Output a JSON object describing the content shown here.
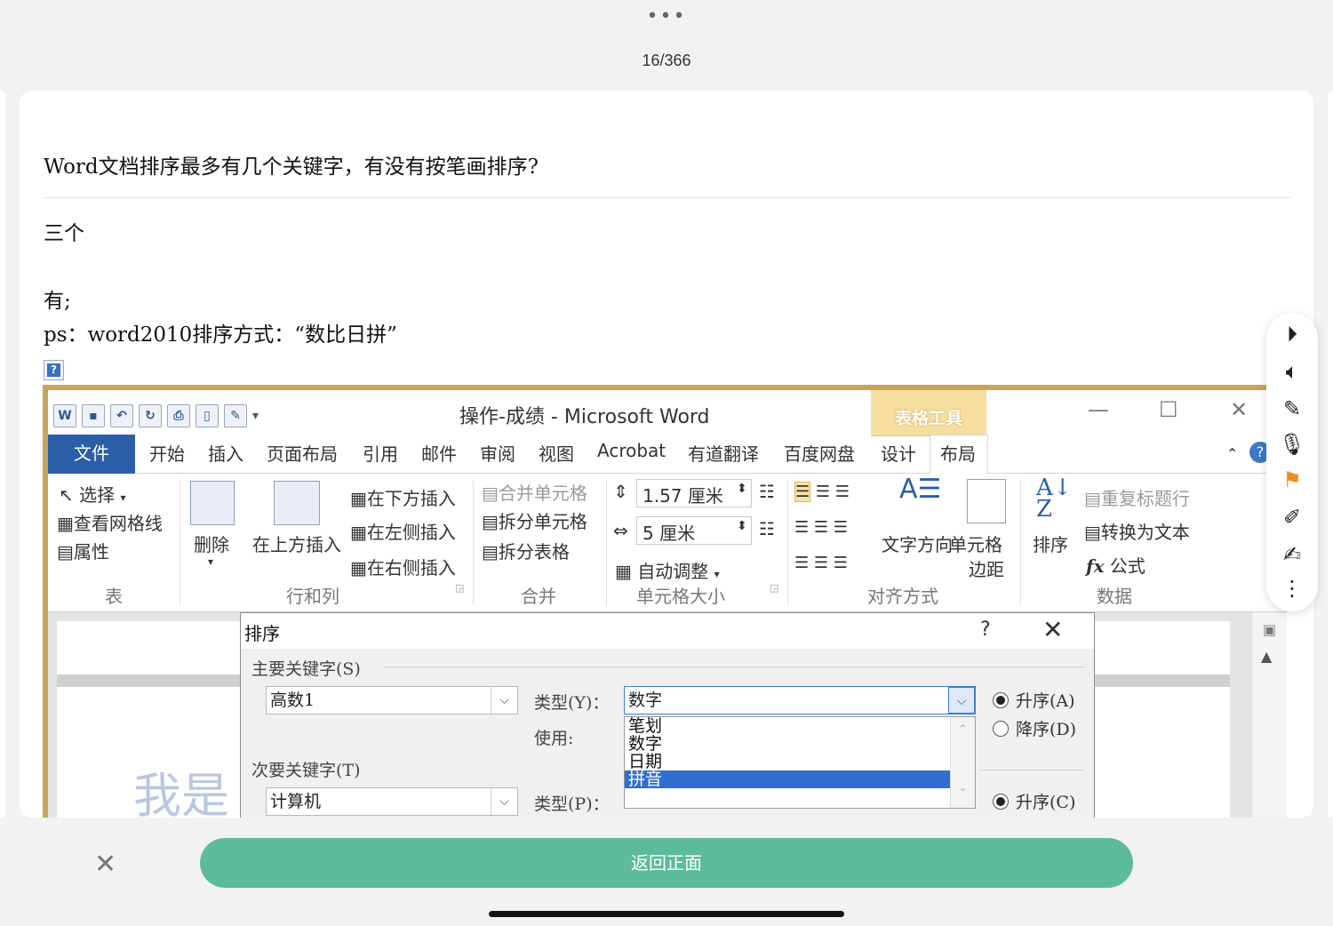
{
  "header": {
    "more_icon": "more-dots-icon",
    "page_counter": "16/366"
  },
  "card": {
    "question": "Word文档排序最多有几个关键字，有没有按笔画排序?",
    "answer_lines": [
      "三个",
      "",
      "有;",
      "ps：word2010排序方式：“数比日拼”"
    ],
    "broken_image_glyph": "?"
  },
  "word": {
    "window_title": "操作-成绩 - Microsoft Word",
    "table_tools": "表格工具",
    "tabs": [
      "文件",
      "开始",
      "插入",
      "页面布局",
      "引用",
      "邮件",
      "审阅",
      "视图",
      "Acrobat",
      "有道翻译",
      "百度网盘",
      "设计",
      "布局"
    ],
    "ribbon": {
      "select": "选择",
      "gridlines": "查看网格线",
      "properties": "属性",
      "delete": "删除",
      "insert_above": "在上方插入",
      "insert_below": "在下方插入",
      "insert_left": "在左侧插入",
      "insert_right": "在右侧插入",
      "merge_cells": "合并单元格",
      "split_cells": "拆分单元格",
      "split_table": "拆分表格",
      "height": "1.57 厘米",
      "width": "5 厘米",
      "autofit": "自动调整",
      "text_direction": "文字方向",
      "cell_margins_1": "单元格",
      "cell_margins_2": "边距",
      "sort": "排序",
      "repeat_header": "重复标题行",
      "convert_text": "转换为文本",
      "formula": "公式",
      "groups": [
        "表",
        "行和列",
        "合并",
        "单元格大小",
        "对齐方式",
        "数据"
      ]
    },
    "watermark": "我是"
  },
  "dialog": {
    "title": "排序",
    "help": "?",
    "primary_key_label": "主要关键字(S)",
    "primary_key_value": "高数1",
    "type_label": "类型(Y)：",
    "type_value": "数字",
    "use_label": "使用:",
    "options": [
      "笔划",
      "数字",
      "日期",
      "拼音"
    ],
    "selected_option": "拼音",
    "asc_a": "升序(A)",
    "desc_d": "降序(D)",
    "secondary_key_label": "次要关键字(T)",
    "secondary_key_value": "计算机",
    "type_p_label": "类型(P)：",
    "asc_c": "升序(C)"
  },
  "bottom": {
    "back_label": "返回正面"
  },
  "colors": {
    "accent": "#5dbb9d",
    "word_blue": "#2b5ea8",
    "flag_orange": "#f08a1c"
  }
}
